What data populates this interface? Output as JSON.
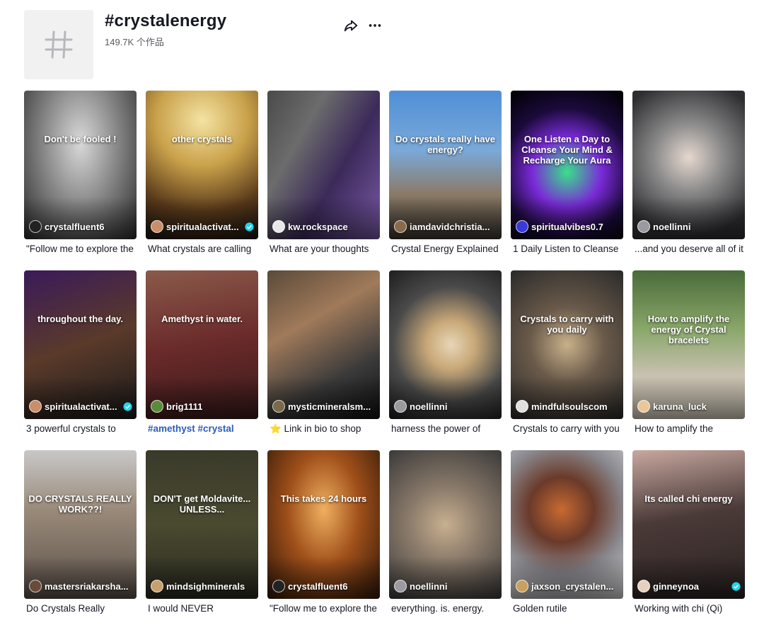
{
  "header": {
    "hashtag": "#crystalenergy",
    "count": "149.7K 个作品",
    "share_icon": "share-icon",
    "more_icon": "more-icon"
  },
  "colors": {
    "text": "#161823",
    "subtext": "#595a61",
    "link": "#2b5db9",
    "verified": "#20d5ec"
  },
  "videos": [
    {
      "author": "crystalfluent6",
      "verified": false,
      "caption": "\"Follow me to explore the",
      "overlay": "Don't be fooled !",
      "bg": "radial-gradient(ellipse at 50% 35%, #d9d9d9 0%, #8a8a8a 45%, #2a2a2a 100%)",
      "avatar": "#222222"
    },
    {
      "author": "spiritualactivat...",
      "verified": true,
      "caption": "What crystals are calling",
      "overlay": "other crystals",
      "bg": "radial-gradient(circle at 50% 20%, #f4e3a3 0%, #c9a14a 35%, #5a3a1a 70%, #1a1410 100%)",
      "avatar": "#c98e6a"
    },
    {
      "author": "kw.rockspace",
      "verified": false,
      "caption": "What are your thoughts",
      "overlay": "",
      "bg": "linear-gradient(120deg, #4a4a4a 0%, #6c6c6c 30%, #3c2a5a 60%, #7a5aa8 100%)",
      "avatar": "#e8e8e8"
    },
    {
      "author": "iamdavidchristia...",
      "verified": false,
      "caption": "Crystal Energy Explained",
      "overlay": "Do crystals really have energy?",
      "bg": "linear-gradient(180deg, #4f8fd8 0%, #7aa9d9 40%, #8a7a66 70%, #3a3530 100%)",
      "avatar": "#8a6a4a"
    },
    {
      "author": "spiritualvibes0.7",
      "verified": false,
      "caption": "1 Daily Listen to Cleanse",
      "overlay": "One Listen a Day to Cleanse Your Mind & Recharge Your Aura",
      "bg": "radial-gradient(circle at 50% 55%, #39e08a 0%, #7a2ad8 35%, #1a0a3a 65%, #000 100%)",
      "avatar": "#3a3ad8"
    },
    {
      "author": "noellinni",
      "verified": false,
      "caption": "...and you deserve all of it",
      "overlay": "",
      "bg": "radial-gradient(circle at 50% 45%, #e6d8cf 0%, #8a8a8a 35%, #2e2e32 80%)",
      "avatar": "#9a9aa0"
    },
    {
      "author": "spiritualactivat...",
      "verified": true,
      "caption": "3 powerful crystals to",
      "overlay": "throughout the day.",
      "bg": "linear-gradient(160deg, #3a1a5a 0%, #5a3a2a 50%, #1a1a1a 100%)",
      "avatar": "#c98e6a"
    },
    {
      "author": "brig1111",
      "verified": false,
      "caption": "#amethyst #crystal",
      "overlay": "Amethyst in water.",
      "bg": "linear-gradient(170deg, #8a5a4a 0%, #6a2a2a 50%, #3a1a1a 100%)",
      "avatar": "#5a8a3a",
      "link": true
    },
    {
      "author": "mysticmineralsm...",
      "verified": false,
      "caption": "⭐ Link in bio to shop",
      "overlay": "",
      "bg": "linear-gradient(150deg, #5a4a3a 0%, #a07a5a 35%, #3a3a3a 70%, #101010 100%)",
      "avatar": "#7a6a4a"
    },
    {
      "author": "noellinni",
      "verified": false,
      "caption": "harness the power of",
      "overlay": "",
      "bg": "radial-gradient(circle at 55% 50%, #e8d6b8 0%, #c8a878 25%, #4a4a4a 60%, #1e1e1e 100%)",
      "avatar": "#9a9aa0"
    },
    {
      "author": "mindfulsoulscom",
      "verified": false,
      "caption": "Crystals to carry with you",
      "overlay": "Crystals to carry with you daily",
      "bg": "radial-gradient(circle at 50% 50%, #c8b08a 0%, #6a5a4a 40%, #2a2a2a 100%)",
      "avatar": "#e0e0e0"
    },
    {
      "author": "karuna_luck",
      "verified": false,
      "caption": "How to amplify the",
      "overlay": "How to amplify the energy of Crystal bracelets",
      "bg": "linear-gradient(180deg, #4a6a3a 0%, #8aa86a 40%, #c8c0b0 70%, #d8d0c0 100%)",
      "avatar": "#e8c89a"
    },
    {
      "author": "mastersriakarsha...",
      "verified": false,
      "caption": "Do Crystals Really",
      "overlay": "DO CRYSTALS REALLY WORK??!",
      "bg": "linear-gradient(180deg, #c8c8c8 0%, #9a8a7a 40%, #5a5048 100%)",
      "avatar": "#6a4a3a"
    },
    {
      "author": "mindsighminerals",
      "verified": false,
      "caption": "I would NEVER",
      "overlay": "DON'T get Moldavite... UNLESS...",
      "bg": "linear-gradient(180deg, #3a3a2a 0%, #4a4a30 50%, #2a2a20 100%)",
      "avatar": "#c8a070"
    },
    {
      "author": "crystalfluent6",
      "verified": false,
      "caption": "\"Follow me to explore the",
      "overlay": "This takes 24 hours",
      "bg": "radial-gradient(ellipse at 50% 40%, #f0b060 0%, #a0501a 45%, #301808 100%)",
      "avatar": "#222222"
    },
    {
      "author": "noellinni",
      "verified": false,
      "caption": "everything. is. energy.",
      "overlay": "",
      "bg": "radial-gradient(circle at 50% 50%, #c8b090 0%, #8a7a6a 40%, #3a3a3a 100%)",
      "avatar": "#9a9aa0"
    },
    {
      "author": "jaxson_crystalen...",
      "verified": false,
      "caption": "Golden rutile",
      "overlay": "",
      "bg": "radial-gradient(circle at 45% 40%, #c86a30 0%, #6a3a2a 30%, #8a8a90 60%, #d8d8d8 100%)",
      "avatar": "#c8a060"
    },
    {
      "author": "ginneynoa",
      "verified": true,
      "caption": "Working with chi (Qi)",
      "overlay": "Its called chi energy",
      "bg": "linear-gradient(170deg, #c8a8a0 0%, #4a3a38 45%, #2a2222 100%)",
      "avatar": "#e8d0c0"
    }
  ]
}
